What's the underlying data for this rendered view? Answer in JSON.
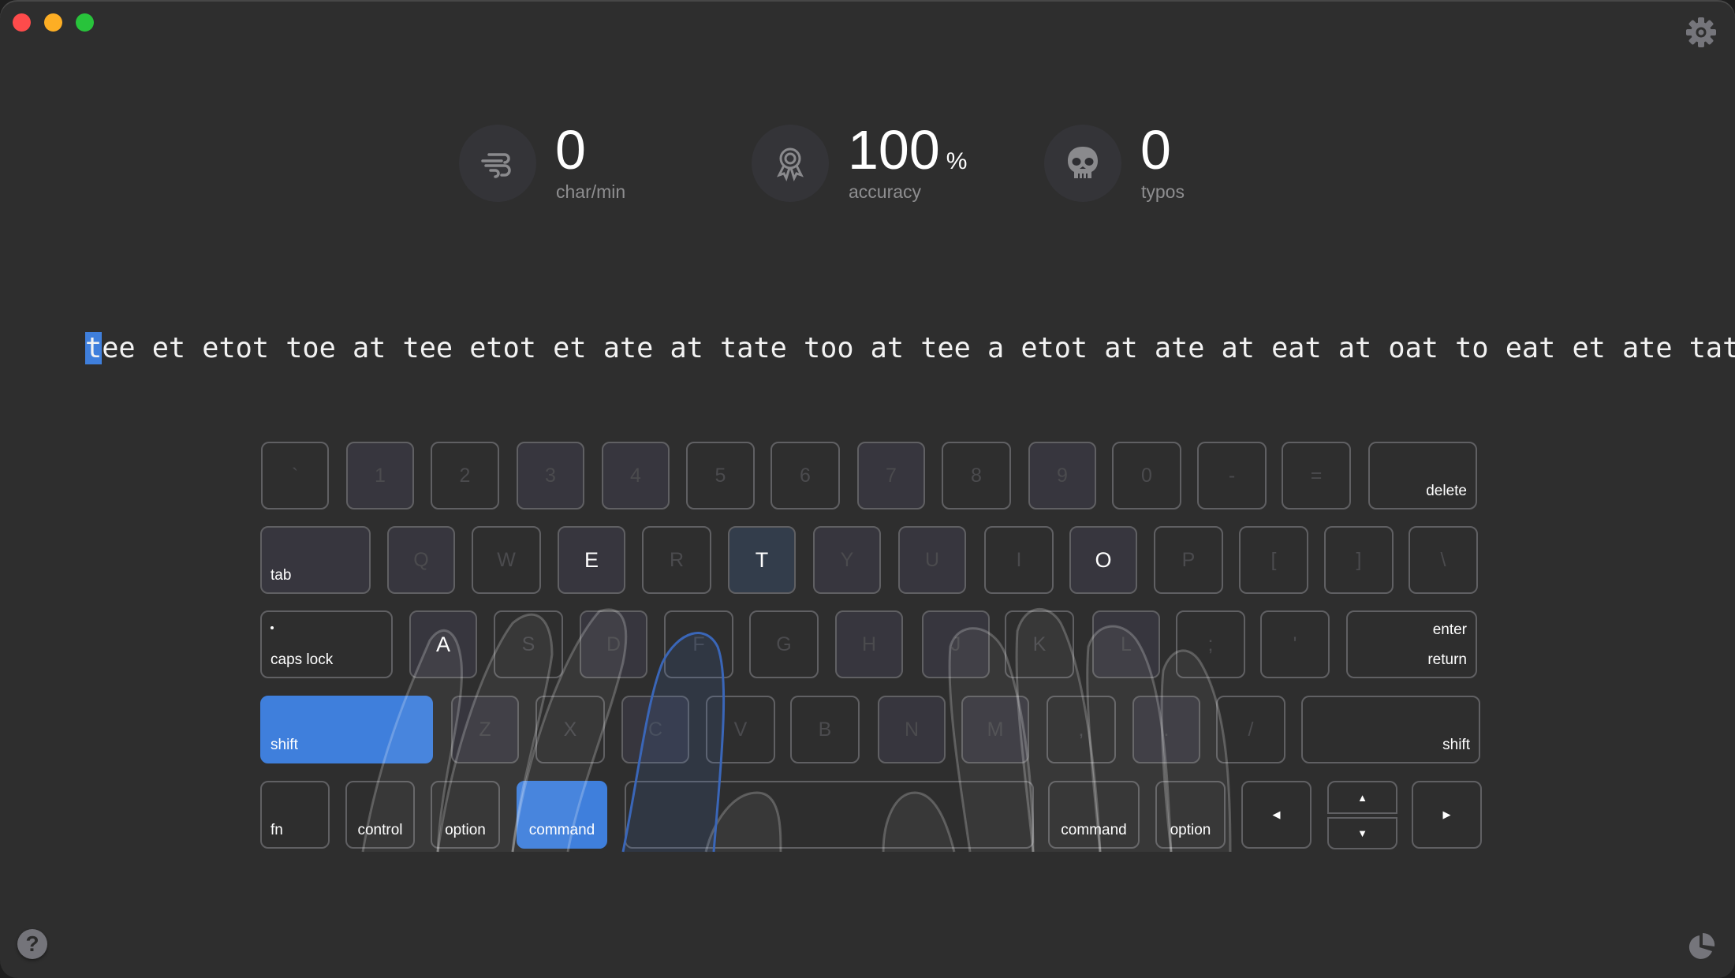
{
  "window": {
    "controls": [
      "close",
      "minimize",
      "maximize"
    ],
    "buttons": {
      "settings": {
        "icon": "gear-icon"
      },
      "help": {
        "icon": "question-icon",
        "label": "?"
      },
      "statistics": {
        "icon": "pie-chart-icon"
      }
    }
  },
  "stats": [
    {
      "icon": "wind-icon",
      "value": "0",
      "unit": "",
      "label": "char/min"
    },
    {
      "icon": "award-ribbon-icon",
      "value": "100",
      "unit": "%",
      "label": "accuracy"
    },
    {
      "icon": "skull-icon",
      "value": "0",
      "unit": "",
      "label": "typos"
    }
  ],
  "lesson": {
    "current_char": "t",
    "remaining_text": "ee et etot toe at tee etot et ate at tate too at tee a etot at ate at eat at oat to eat et ate tata"
  },
  "keyboard": {
    "colors": {
      "active": "#3f7fdc",
      "next": "#333d4b"
    },
    "rows": [
      [
        {
          "label": "`"
        },
        {
          "label": "1"
        },
        {
          "label": "2"
        },
        {
          "label": "3"
        },
        {
          "label": "4"
        },
        {
          "label": "5"
        },
        {
          "label": "6"
        },
        {
          "label": "7"
        },
        {
          "label": "8"
        },
        {
          "label": "9"
        },
        {
          "label": "0"
        },
        {
          "label": "-"
        },
        {
          "label": "="
        },
        {
          "label": "delete"
        }
      ],
      [
        {
          "label": "tab"
        },
        {
          "label": "Q"
        },
        {
          "label": "W"
        },
        {
          "label": "E"
        },
        {
          "label": "R"
        },
        {
          "label": "T"
        },
        {
          "label": "Y"
        },
        {
          "label": "U"
        },
        {
          "label": "I"
        },
        {
          "label": "O"
        },
        {
          "label": "P"
        },
        {
          "label": "["
        },
        {
          "label": "]"
        },
        {
          "label": "\\"
        }
      ],
      [
        {
          "label": "caps lock"
        },
        {
          "label": "A"
        },
        {
          "label": "S"
        },
        {
          "label": "D"
        },
        {
          "label": "F"
        },
        {
          "label": "G"
        },
        {
          "label": "H"
        },
        {
          "label": "J"
        },
        {
          "label": "K"
        },
        {
          "label": "L"
        },
        {
          "label": ";"
        },
        {
          "label": "'"
        },
        {
          "label": "enter",
          "label2": "return"
        }
      ],
      [
        {
          "label": "shift"
        },
        {
          "label": "Z"
        },
        {
          "label": "X"
        },
        {
          "label": "C"
        },
        {
          "label": "V"
        },
        {
          "label": "B"
        },
        {
          "label": "N"
        },
        {
          "label": "M"
        },
        {
          "label": ","
        },
        {
          "label": "."
        },
        {
          "label": "/"
        },
        {
          "label": "shift"
        }
      ],
      [
        {
          "label": "fn"
        },
        {
          "label": "control"
        },
        {
          "label": "option"
        },
        {
          "label": "command"
        },
        {
          "label": ""
        },
        {
          "label": "command"
        },
        {
          "label": "option"
        },
        {
          "label": "◀"
        },
        {
          "label": "▲"
        },
        {
          "label": "▼"
        },
        {
          "label": "▶"
        }
      ]
    ],
    "pressed_keys": [
      "shift-left",
      "command-left"
    ],
    "next_key": "T",
    "lesson_keys": [
      "E",
      "T",
      "O",
      "A"
    ]
  }
}
